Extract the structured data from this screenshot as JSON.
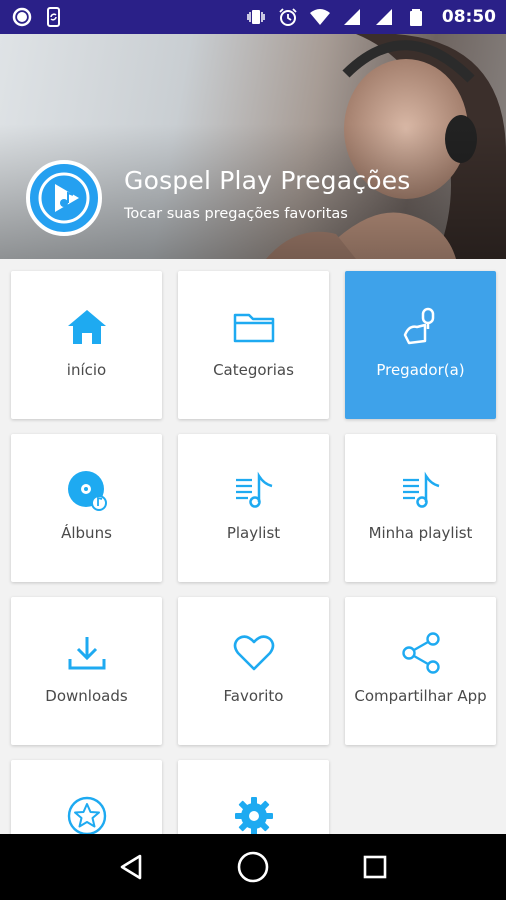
{
  "status_bar": {
    "time": "08:50",
    "left_icons": [
      "circle-notification-icon",
      "phone-sync-icon"
    ],
    "right_icons": [
      "vibrate-icon",
      "alarm-icon",
      "wifi-icon",
      "signal-icon",
      "signal-icon",
      "battery-icon"
    ],
    "background": "#2a2088"
  },
  "header": {
    "title": "Gospel Play Pregações",
    "subtitle": "Tocar suas pregações favoritas",
    "logo_icon": "play-note-logo-icon"
  },
  "menu": {
    "accent": "#1eaaf1",
    "active_color": "#3ea2ea",
    "items": [
      {
        "label": "início",
        "icon": "home-icon",
        "active": false
      },
      {
        "label": "Categorias",
        "icon": "folder-icon",
        "active": false
      },
      {
        "label": "Pregador(a)",
        "icon": "preacher-icon",
        "active": true
      },
      {
        "label": "Álbuns",
        "icon": "album-disc-icon",
        "active": false
      },
      {
        "label": "Playlist",
        "icon": "playlist-icon",
        "active": false
      },
      {
        "label": "Minha playlist",
        "icon": "playlist-icon",
        "active": false
      },
      {
        "label": "Downloads",
        "icon": "download-icon",
        "active": false
      },
      {
        "label": "Favorito",
        "icon": "heart-icon",
        "active": false
      },
      {
        "label": "Compartilhar App",
        "icon": "share-icon",
        "active": false
      },
      {
        "label": "",
        "icon": "star-icon",
        "active": false
      },
      {
        "label": "",
        "icon": "gear-icon",
        "active": false
      }
    ]
  },
  "nav_bar": {
    "buttons": [
      "back-icon",
      "home-circle-icon",
      "recents-icon"
    ]
  }
}
